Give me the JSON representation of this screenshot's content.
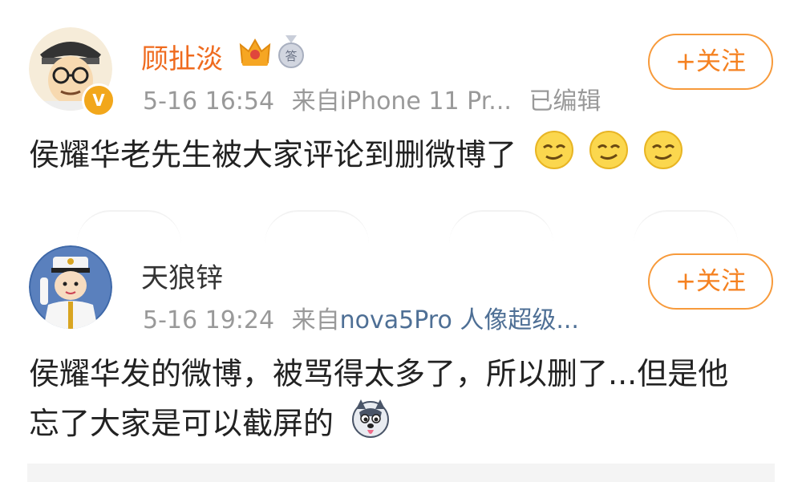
{
  "posts": [
    {
      "user": {
        "name": "顾扯淡",
        "verified_badge": "V",
        "name_color": "#ef6b1f",
        "badges": [
          "crown-icon",
          "medal-icon"
        ],
        "medal_text": "答"
      },
      "meta": {
        "time": "5-16 16:54",
        "source_prefix": "来自",
        "source": "iPhone 11 Pr...",
        "edited": "已编辑"
      },
      "follow_label": "+关注",
      "content": "侯耀华老先生被大家评论到删微博了",
      "emojis": [
        "smirk-emoji",
        "smirk-emoji",
        "smirk-emoji"
      ]
    },
    {
      "user": {
        "name": "天狼锌",
        "name_color": "#333333"
      },
      "meta": {
        "time": "5-16 19:24",
        "source_prefix": "来自",
        "source": "nova5Pro 人像超级..."
      },
      "follow_label": "+关注",
      "content_lines": [
        "侯耀华发的微博，被骂得太多了，所以删了...但是他",
        "忘了大家是可以截屏的"
      ],
      "emojis": [
        "husky-emoji"
      ]
    }
  ],
  "colors": {
    "accent": "#f58120",
    "link": "#4e6f95",
    "meta": "#999999"
  }
}
